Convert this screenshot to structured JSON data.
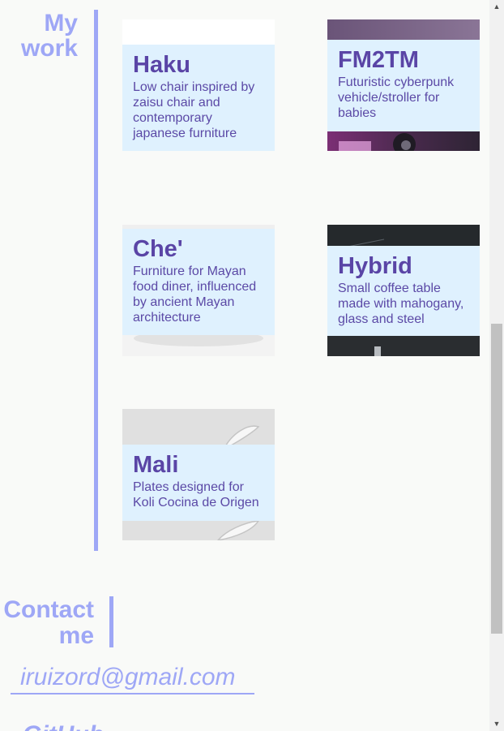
{
  "work": {
    "heading_line1": "My",
    "heading_line2": "work",
    "projects": [
      {
        "title": "Haku",
        "description": "Low chair inspired by zaisu chair and contemporary japanese furniture"
      },
      {
        "title": "FM2TM",
        "description": "Futuristic cyberpunk vehicle/stroller for babies"
      },
      {
        "title": "Che'",
        "description": "Furniture for Mayan food diner, influenced by ancient Mayan architecture"
      },
      {
        "title": "Hybrid",
        "description": "Small coffee table made with mahogany, glass and steel"
      },
      {
        "title": "Mali",
        "description": "Plates designed for Koli Cocina de Origen"
      }
    ]
  },
  "contact": {
    "heading_line1": "Contact",
    "heading_line2": "me",
    "email": "iruizord@gmail.com",
    "github": "GitHub"
  },
  "colors": {
    "accent": "#9ea7f6",
    "card_panel": "#dff1fe",
    "card_title": "#5a45a6",
    "background": "#f9faf8"
  }
}
